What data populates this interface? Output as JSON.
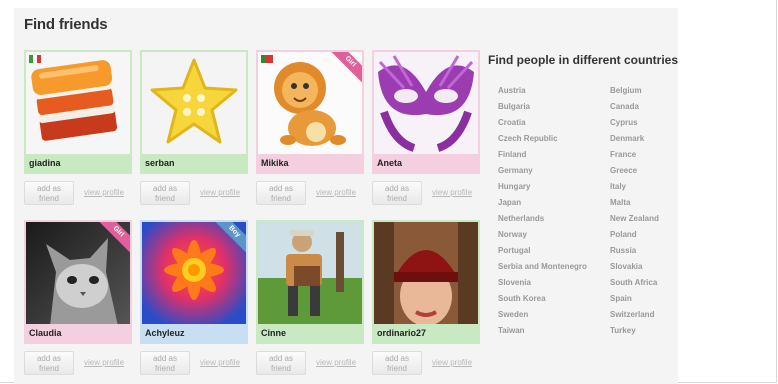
{
  "page_title": "Find friends",
  "countries_title": "Find people in different countries",
  "buttons": {
    "add_friend": "add as\nfriend",
    "view_profile": "view profile"
  },
  "users": [
    {
      "name": "giadina",
      "theme": "green",
      "image": "orange-layered-sponge-photo",
      "flag_colors": [
        "#3a9a3a",
        "#ffffff",
        "#d33"
      ]
    },
    {
      "name": "serban",
      "theme": "green",
      "image": "yellow-star-button-photo"
    },
    {
      "name": "Mikika",
      "theme": "pink",
      "image": "cartoon-lion-photo",
      "badge": "Girl",
      "flag_colors": [
        "#2e8b2e",
        "#d33",
        "#d33"
      ]
    },
    {
      "name": "Aneta",
      "theme": "pink",
      "image": "purple-feather-mask-photo"
    },
    {
      "name": "Claudia",
      "theme": "pink",
      "image": "black-white-cat-photo",
      "badge": "Girl"
    },
    {
      "name": "Achyleuz",
      "theme": "blue",
      "image": "orange-blue-flower-photo",
      "badge": "Boy"
    },
    {
      "name": "Cinne",
      "theme": "green",
      "image": "man-with-accordion-photo"
    },
    {
      "name": "ordinario27",
      "theme": "green",
      "image": "woman-with-red-hat-photo"
    }
  ],
  "countries": [
    "Austria",
    "Belgium",
    "Bulgaria",
    "Canada",
    "Croatia",
    "Cyprus",
    "Czech Republic",
    "Denmark",
    "Finland",
    "France",
    "Germany",
    "Greece",
    "Hungary",
    "Italy",
    "Japan",
    "Malta",
    "Netherlands",
    "New Zealand",
    "Norway",
    "Poland",
    "Portugal",
    "Russia",
    "Serbia and Montenegro",
    "Slovakia",
    "Slovenia",
    "South Africa",
    "South Korea",
    "Spain",
    "Sweden",
    "Switzerland",
    "Taiwan",
    "Turkey"
  ]
}
